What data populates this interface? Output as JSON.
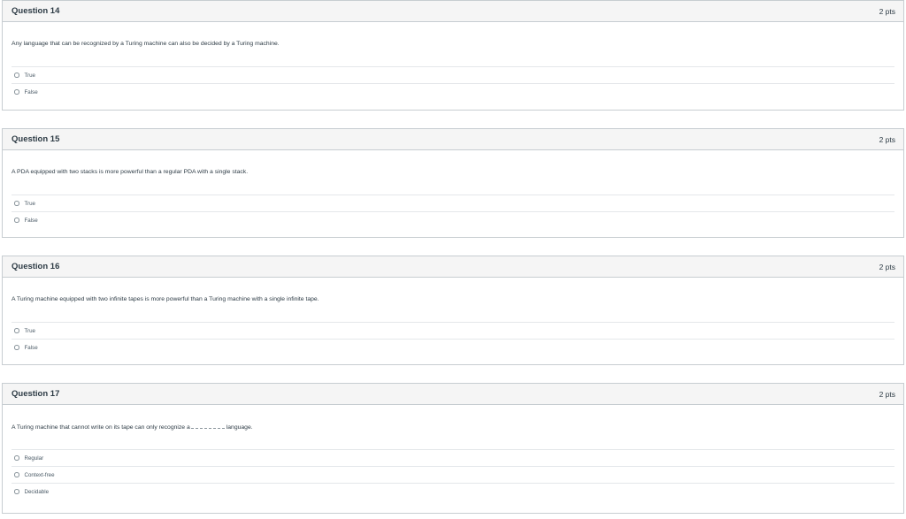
{
  "questions": [
    {
      "title": "Question 14",
      "points": "2 pts",
      "text": "Any language that can be recognized by a Turing machine can also be decided by a Turing machine.",
      "answers": [
        "True",
        "False"
      ]
    },
    {
      "title": "Question 15",
      "points": "2 pts",
      "text": "A PDA equipped with two stacks is more powerful than a regular PDA with a single stack.",
      "answers": [
        "True",
        "False"
      ]
    },
    {
      "title": "Question 16",
      "points": "2 pts",
      "text": "A Turing machine equipped with two infinite tapes is more powerful than a Turing machine with a single infinite tape.",
      "answers": [
        "True",
        "False"
      ]
    },
    {
      "title": "Question 17",
      "points": "2 pts",
      "text_before_blank": "A Turing machine that cannot write on its tape can only recognize a",
      "text_after_blank": "language.",
      "answers": [
        "Regular",
        "Context-free",
        "Decidable"
      ]
    }
  ]
}
